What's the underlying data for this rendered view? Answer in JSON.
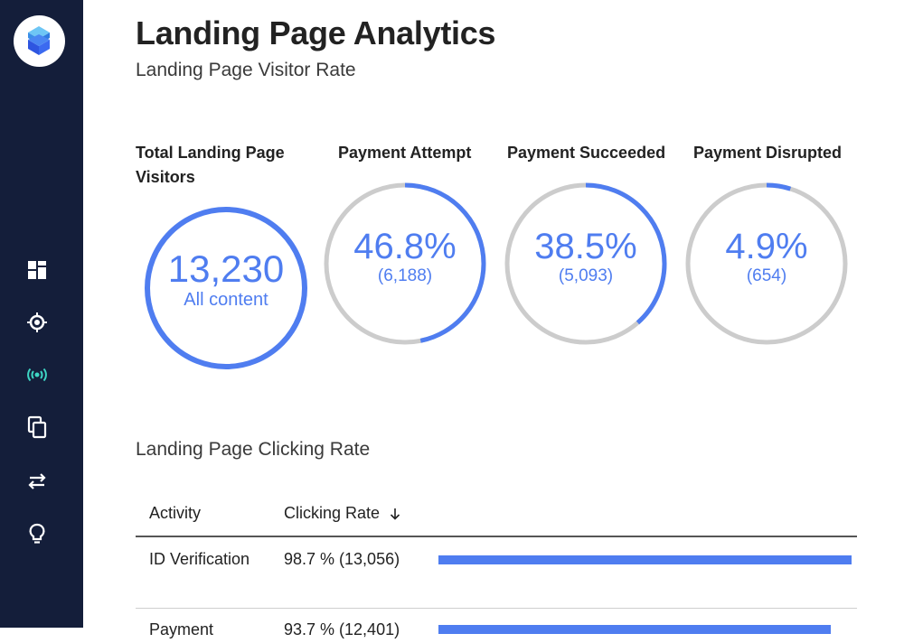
{
  "app": {
    "accent": "#4f7df0",
    "sidebar_bg": "#141e3a"
  },
  "sidebar": {
    "logo_icon": "cube-logo-icon",
    "items": [
      {
        "icon": "dashboard-icon"
      },
      {
        "icon": "chip-icon"
      },
      {
        "icon": "broadcast-icon"
      },
      {
        "icon": "copy-icon"
      },
      {
        "icon": "transfer-icon"
      },
      {
        "icon": "lightbulb-icon"
      }
    ]
  },
  "header": {
    "title": "Landing Page Analytics",
    "subtitle": "Landing Page Visitor Rate"
  },
  "metrics": {
    "total": {
      "label": "Total Landing Page Visitors",
      "value": "13,230",
      "caption": "All content"
    },
    "attempt": {
      "label": "Payment Attempt",
      "percent": "46.8%",
      "count": "(6,188)",
      "fraction": 0.468
    },
    "succeeded": {
      "label": "Payment Succeeded",
      "percent": "38.5%",
      "count": "(5,093)",
      "fraction": 0.385
    },
    "disrupted": {
      "label": "Payment Disrupted",
      "percent": "4.9%",
      "count": "(654)",
      "fraction": 0.049
    }
  },
  "clicking": {
    "title": "Landing Page Clicking Rate",
    "columns": [
      "Activity",
      "Clicking Rate"
    ],
    "sort_icon": "arrow-down-icon",
    "rows": [
      {
        "activity": "ID Verification",
        "rate": "98.7 % (13,056)",
        "fraction": 0.987
      },
      {
        "activity": "Payment",
        "rate": "93.7 % (12,401)",
        "fraction": 0.937
      }
    ]
  }
}
